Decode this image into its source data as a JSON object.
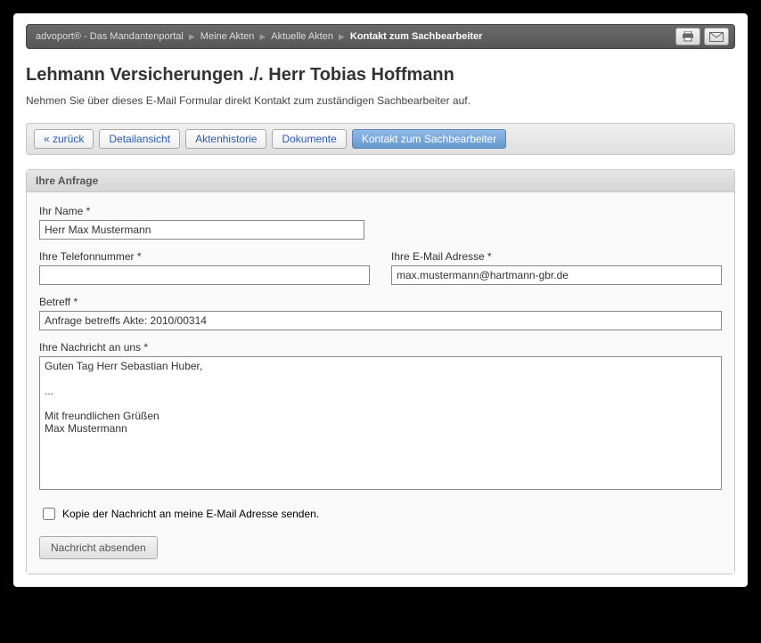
{
  "breadcrumb": {
    "items": [
      "advoport® - Das Mandantenportal",
      "Meine Akten",
      "Aktuelle Akten",
      "Kontakt zum Sachbearbeiter"
    ]
  },
  "title": "Lehmann Versicherungen ./. Herr Tobias Hoffmann",
  "subtitle": "Nehmen Sie über dieses E-Mail Formular direkt Kontakt zum zuständigen Sachbearbeiter auf.",
  "tabs": {
    "back": "« zurück",
    "detail": "Detailansicht",
    "history": "Aktenhistorie",
    "documents": "Dokumente",
    "contact": "Kontakt zum Sachbearbeiter"
  },
  "panel": {
    "header": "Ihre Anfrage"
  },
  "form": {
    "name_label": "Ihr Name *",
    "name_value": "Herr Max Mustermann",
    "phone_label": "Ihre Telefonnummer *",
    "phone_value": "",
    "email_label": "Ihre E-Mail Adresse *",
    "email_value": "max.mustermann@hartmann-gbr.de",
    "subject_label": "Betreff *",
    "subject_value": "Anfrage betreffs Akte: 2010/00314",
    "message_label": "Ihre Nachricht an uns *",
    "message_value": "Guten Tag Herr Sebastian Huber,\n\n...\n\nMit freundlichen Grüßen\nMax Mustermann",
    "copy_label": "Kopie der Nachricht an meine E-Mail Adresse senden.",
    "submit_label": "Nachricht absenden"
  }
}
